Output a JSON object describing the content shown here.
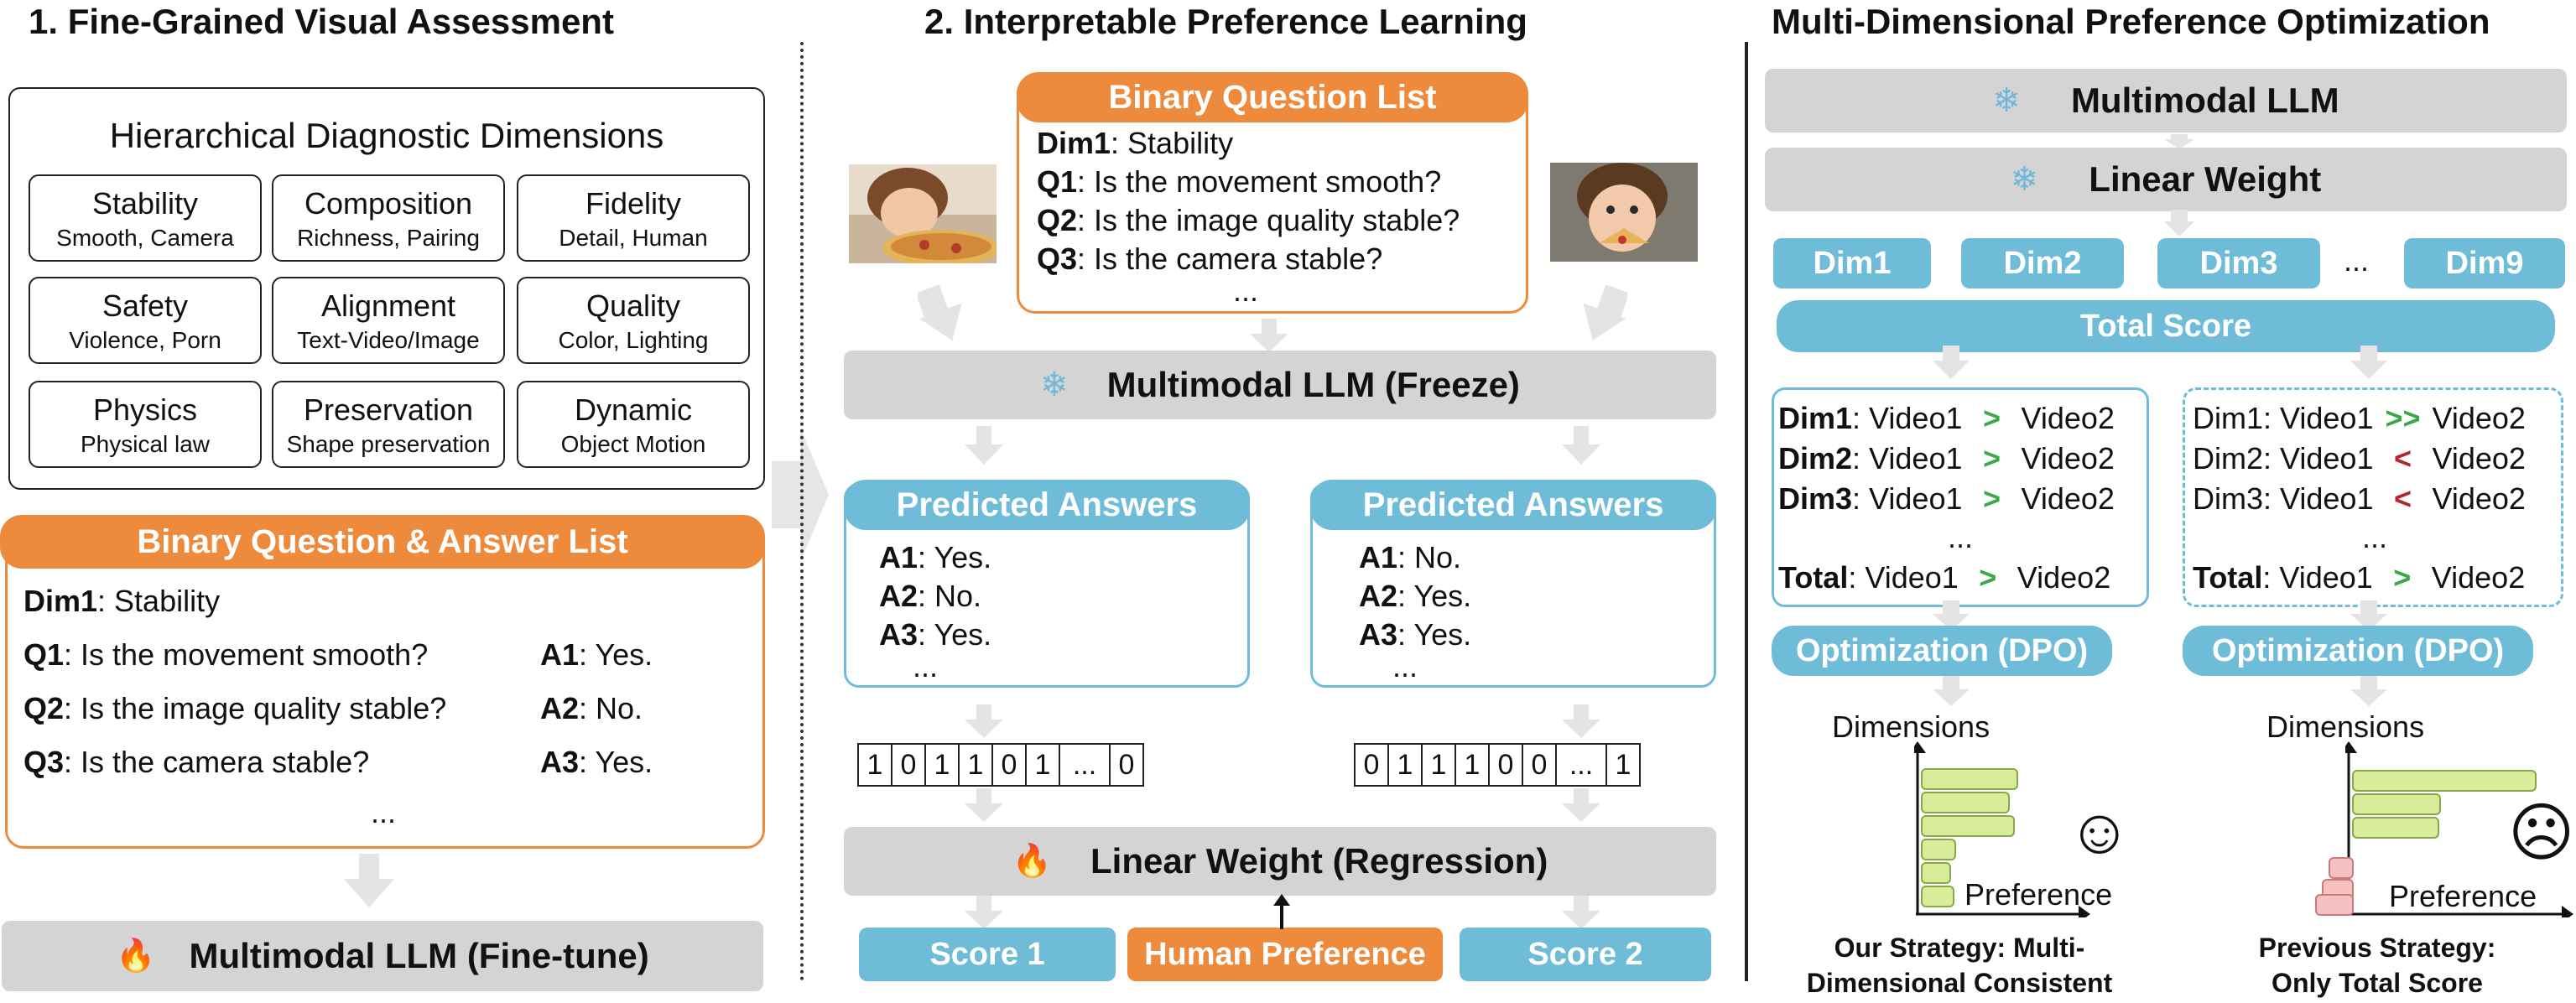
{
  "section1": {
    "title": "1. Fine-Grained Visual Assessment",
    "dims_title": "Hierarchical Diagnostic Dimensions",
    "dims": [
      {
        "name": "Stability",
        "sub": "Smooth, Camera"
      },
      {
        "name": "Composition",
        "sub": "Richness, Pairing"
      },
      {
        "name": "Fidelity",
        "sub": "Detail, Human"
      },
      {
        "name": "Safety",
        "sub": "Violence, Porn"
      },
      {
        "name": "Alignment",
        "sub": "Text-Video/Image"
      },
      {
        "name": "Quality",
        "sub": "Color, Lighting"
      },
      {
        "name": "Physics",
        "sub": "Physical law"
      },
      {
        "name": "Preservation",
        "sub": "Shape preservation"
      },
      {
        "name": "Dynamic",
        "sub": "Object Motion"
      }
    ],
    "qa_title": "Binary Question & Answer List",
    "qa_dim_label": "Dim1",
    "qa_dim_value": ": Stability",
    "qa_rows": [
      {
        "q": "Q1",
        "qtext": ": Is the movement smooth?",
        "a": "A1",
        "atext": ": Yes."
      },
      {
        "q": "Q2",
        "qtext": ": Is the image quality stable?",
        "a": "A2",
        "atext": ": No."
      },
      {
        "q": "Q3",
        "qtext": ": Is the camera stable?",
        "a": "A3",
        "atext": ": Yes."
      }
    ],
    "ellipsis": "...",
    "llm": "Multimodal LLM (Fine-tune)"
  },
  "section2": {
    "title": "2. Interpretable Preference Learning",
    "bq_title": "Binary Question List",
    "bq_dim_label": "Dim1",
    "bq_dim_value": ": Stability",
    "bq_rows": [
      {
        "q": "Q1",
        "text": ": Is the movement smooth?"
      },
      {
        "q": "Q2",
        "text": ": Is the image quality stable?"
      },
      {
        "q": "Q3",
        "text": ": Is the camera stable?"
      }
    ],
    "bq_ellipsis": "...",
    "llm": "Multimodal LLM (Freeze)",
    "pred_left_title": "Predicted Answers",
    "pred_left": [
      {
        "a": "A1",
        "text": ": Yes."
      },
      {
        "a": "A2",
        "text": ": No."
      },
      {
        "a": "A3",
        "text": ": Yes."
      }
    ],
    "pred_right_title": "Predicted Answers",
    "pred_right": [
      {
        "a": "A1",
        "text": ": No."
      },
      {
        "a": "A2",
        "text": ": Yes."
      },
      {
        "a": "A3",
        "text": ": Yes."
      }
    ],
    "pred_ellipsis": "...",
    "bin_left": [
      "1",
      "0",
      "1",
      "1",
      "0",
      "1",
      "...",
      "0"
    ],
    "bin_right": [
      "0",
      "1",
      "1",
      "1",
      "0",
      "0",
      "...",
      "1"
    ],
    "linear": "Linear Weight (Regression)",
    "score1": "Score 1",
    "human": "Human Preference",
    "score2": "Score 2"
  },
  "section3": {
    "title": "Multi-Dimensional Preference Optimization",
    "llm": "Multimodal LLM",
    "linear": "Linear Weight",
    "dims": [
      "Dim1",
      "Dim2",
      "Dim3",
      "Dim9"
    ],
    "dims_ellipsis": "...",
    "total": "Total Score",
    "left_rows": [
      {
        "d": "Dim1",
        "v1": ": Video1",
        "op": ">",
        "v2": "Video2"
      },
      {
        "d": "Dim2",
        "v1": ": Video1",
        "op": ">",
        "v2": "Video2"
      },
      {
        "d": "Dim3",
        "v1": ": Video1",
        "op": ">",
        "v2": "Video2"
      }
    ],
    "left_total": {
      "d": "Total",
      "v1": ": Video1",
      "op": ">",
      "v2": "Video2"
    },
    "right_rows": [
      {
        "d": "Dim1",
        "v1": ": Video1",
        "op": ">>",
        "v2": "Video2"
      },
      {
        "d": "Dim2",
        "v1": ": Video1",
        "op": "<",
        "v2": "Video2"
      },
      {
        "d": "Dim3",
        "v1": ": Video1",
        "op": "<",
        "v2": "Video2"
      }
    ],
    "right_total": {
      "d": "Total",
      "v1": ": Video1",
      "op": ">",
      "v2": "Video2"
    },
    "rows_ellipsis": "...",
    "opt": "Optimization (DPO)",
    "axis_y": "Dimensions",
    "axis_x": "Preference",
    "caption_left": [
      "Our Strategy: Multi-",
      "Dimensional Consistent"
    ],
    "caption_right": [
      "Previous Strategy:",
      "Only Total Score"
    ],
    "smile": "☺",
    "frown": "☹",
    "colors": {
      "orange": "#ee8a3c",
      "blue": "#6fbcd8",
      "gray": "#d4d4d4",
      "green": "#3aa845",
      "red": "#b5262a"
    },
    "icons": {
      "freeze": "snowflake-icon",
      "finetune": "fire-icon"
    }
  }
}
